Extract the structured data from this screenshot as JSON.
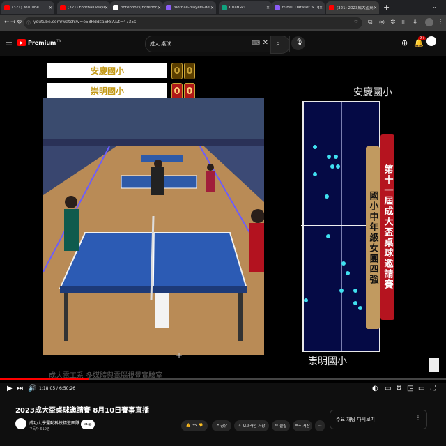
{
  "tabs": [
    {
      "label": "(321) YouTube",
      "icon_color": "#ff0000",
      "active": false
    },
    {
      "label": "(321) Football Players Track",
      "icon_color": "#ff0000",
      "active": false
    },
    {
      "label": "notebooks/notebooks/how",
      "icon_color": "#ffffff",
      "active": false
    },
    {
      "label": "football-players-detection",
      "icon_color": "#8b5cf6",
      "active": false
    },
    {
      "label": "ChatGPT",
      "icon_color": "#10a37f",
      "active": false
    },
    {
      "label": "tt-ball Dataset > Upload",
      "icon_color": "#8b5cf6",
      "active": false
    },
    {
      "label": "(321) 2023成大盃桌球邀請",
      "icon_color": "#ff0000",
      "active": true
    }
  ],
  "new_tab": "+",
  "url": "youtube.com/watch?v=e58Hddca6F8A&t=4735s",
  "youtube": {
    "logo": "Premium",
    "logo_sup": "TW",
    "search_value": "成大 桌球",
    "notification_badge": "9+"
  },
  "scoreboard": [
    {
      "team": "安慶國小",
      "games": "0",
      "points": "0",
      "points_color": "#5a3e00"
    },
    {
      "team": "崇明國小",
      "games": "0",
      "points": "0",
      "points_color": "#b01818"
    }
  ],
  "map": {
    "top_team": "安慶國小",
    "bottom_team": "崇明國小",
    "players_top": [
      [
        0.12,
        0.17
      ],
      [
        0.31,
        0.21
      ],
      [
        0.35,
        0.25
      ],
      [
        0.4,
        0.21
      ],
      [
        0.43,
        0.25
      ],
      [
        0.12,
        0.28
      ],
      [
        0.28,
        0.37
      ]
    ],
    "players_bottom": [
      [
        0.3,
        0.53
      ],
      [
        0.5,
        0.64
      ],
      [
        0.56,
        0.68
      ],
      [
        0.47,
        0.75
      ],
      [
        0.66,
        0.75
      ],
      [
        0.66,
        0.8
      ],
      [
        0.85,
        0.8
      ],
      [
        0.72,
        0.82
      ],
      [
        0.0,
        0.79
      ]
    ]
  },
  "banner_red": "第十一屆成大盃桌球邀請賽",
  "banner_gold": "國小中年級女團四強",
  "watermark": "成大電工系 多媒體與電腦視覺實驗室",
  "player": {
    "progress": 0.2,
    "time": "1:18:05 / 6:50:26"
  },
  "video_title": "2023成大盃桌球邀請賽 8月10日賽事直播",
  "channel": {
    "name": "成功大學運動科技精進團隊",
    "subscribers": "구독자 619명",
    "subscribe_label": "구독"
  },
  "actions": [
    {
      "label": "35",
      "icon": "thumbs-up-icon"
    },
    {
      "label": "공유",
      "icon": "share-icon"
    },
    {
      "label": "오프라인 저장",
      "icon": "download-icon"
    },
    {
      "label": "클립",
      "icon": "clip-icon"
    },
    {
      "label": "저장",
      "icon": "save-icon"
    }
  ],
  "live_chat": "주요 채팅 다시보기"
}
